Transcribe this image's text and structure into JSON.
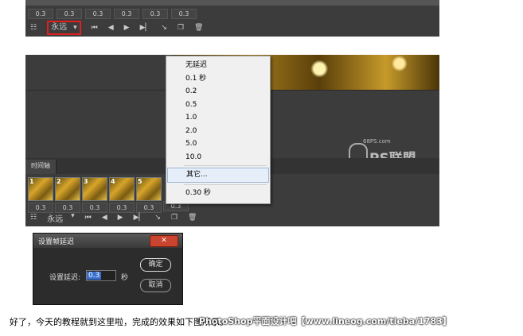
{
  "top_panel": {
    "frame_delays": [
      "0.3",
      "0.3",
      "0.3",
      "0.3",
      "0.3",
      "0.3"
    ],
    "loop_value": "永远"
  },
  "timeline_panel": {
    "tab_label": "时间轴",
    "frames": [
      {
        "num": "1",
        "delay": "0.3"
      },
      {
        "num": "2",
        "delay": "0.3"
      },
      {
        "num": "3",
        "delay": "0.3"
      },
      {
        "num": "4",
        "delay": "0.3"
      },
      {
        "num": "5",
        "delay": "0.3"
      },
      {
        "num": "",
        "delay": "0.3"
      }
    ],
    "loop_value": "永远",
    "watermark_site": "68PS.com",
    "watermark_logo": "PS联盟"
  },
  "delay_menu": {
    "items": [
      "无延迟",
      "0.1 秒",
      "0.2",
      "0.5",
      "1.0",
      "2.0",
      "5.0",
      "10.0"
    ],
    "other": "其它...",
    "current": "0.30 秒"
  },
  "dialog": {
    "title": "设置帧延迟",
    "label": "设置延迟:",
    "value": "0.3",
    "unit": "秒",
    "ok": "确定",
    "cancel": "取消"
  },
  "caption": "好了，今天的教程就到这里啦，完成的效果如下图所示。",
  "watermark": "PhotoShop平面设计吧【www.lineog.com/tieba/1783】",
  "colors": {
    "panel": "#3c3c3c",
    "highlight_box": "#e02020",
    "menu_bg": "#f0f0f0"
  }
}
